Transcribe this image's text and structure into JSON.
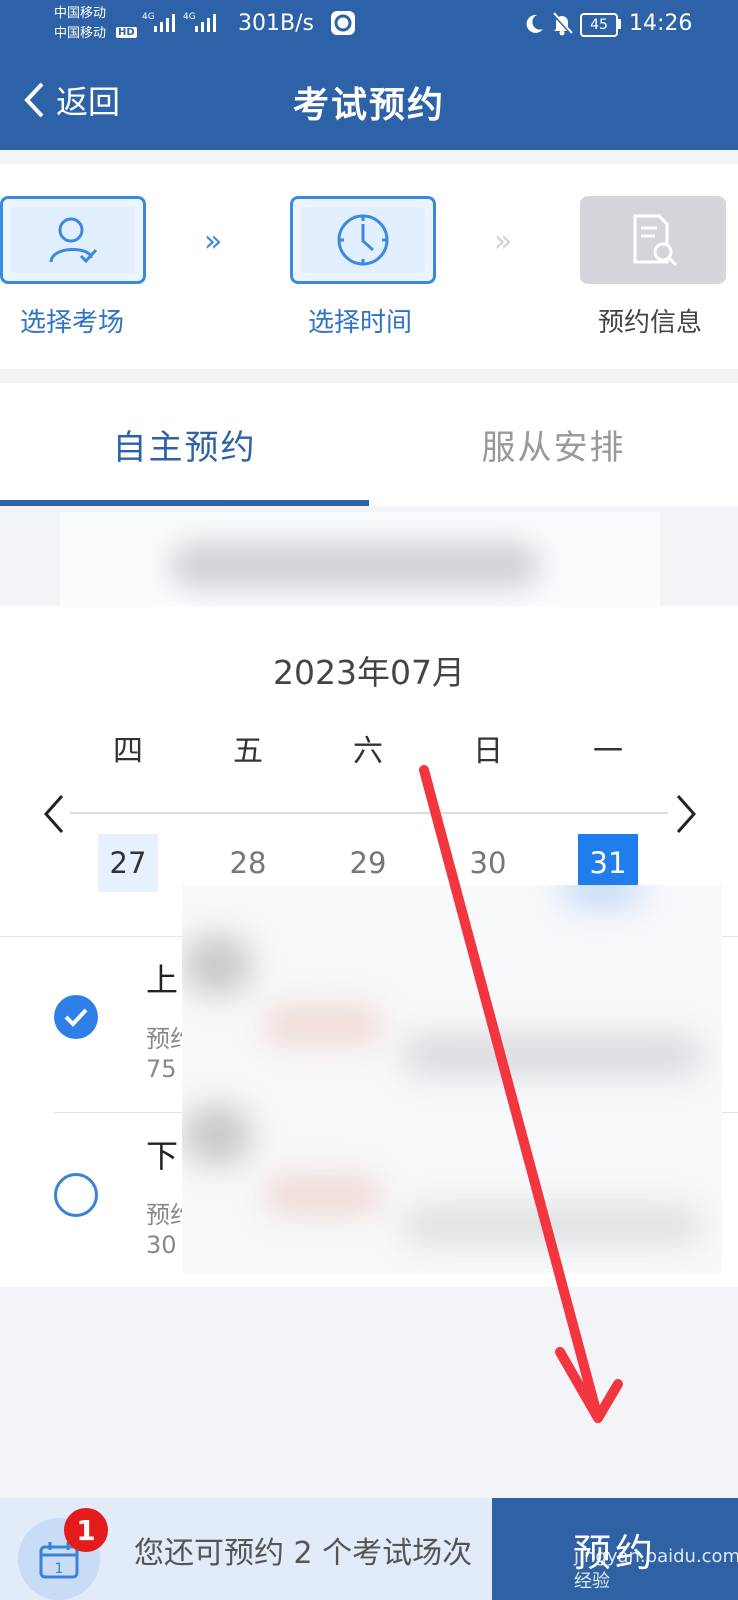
{
  "status_bar": {
    "carrier_1": "中国移动",
    "carrier_2": "中国移动",
    "hd": "HD",
    "net_1": "4G",
    "net_2": "4G",
    "speed": "301B/s",
    "battery": "45",
    "time": "14:26"
  },
  "header": {
    "back_label": "返回",
    "title": "考试预约"
  },
  "steps": [
    {
      "label": "选择考场"
    },
    {
      "label": "选择时间"
    },
    {
      "label": "预约信息"
    }
  ],
  "tabs": [
    {
      "label": "自主预约"
    },
    {
      "label": "服从安排"
    }
  ],
  "calendar": {
    "month": "2023年07月",
    "weekdays": [
      "四",
      "五",
      "六",
      "日",
      "一"
    ],
    "days": [
      "27",
      "28",
      "29",
      "30",
      "31"
    ]
  },
  "sessions": [
    {
      "title_visible": "上",
      "sub1_visible": "预约",
      "sub2_visible": "75"
    },
    {
      "title_visible": "下",
      "sub1_visible": "预约",
      "sub2_visible": "30"
    }
  ],
  "bottom": {
    "badge": "1",
    "remaining": "您还可预约 2 个考试场次",
    "book_label": "预约"
  },
  "watermark": "jingyan.baidu.com 经验",
  "colors": {
    "primary": "#2e62a8",
    "accent": "#1f7eeb",
    "badge": "#e31b1b",
    "arrow": "#f2353f"
  }
}
